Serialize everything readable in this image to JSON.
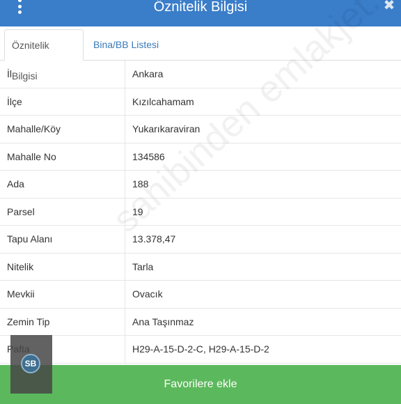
{
  "header": {
    "title": "Öznitelik Bilgisi",
    "menu_icon": "vertical-dots-icon",
    "close_icon": "close-icon"
  },
  "tabs": [
    {
      "label": "Öznitelik Bilgisi",
      "active": true
    },
    {
      "label": "Bina/BB Listesi",
      "active": false
    }
  ],
  "rows": [
    {
      "key": "İl",
      "value": "Ankara"
    },
    {
      "key": "İlçe",
      "value": "Kızılcahamam"
    },
    {
      "key": "Mahalle/Köy",
      "value": "Yukarıkaraviran"
    },
    {
      "key": "Mahalle No",
      "value": "134586"
    },
    {
      "key": "Ada",
      "value": "188"
    },
    {
      "key": "Parsel",
      "value": "19"
    },
    {
      "key": "Tapu Alanı",
      "value": "13.378,47"
    },
    {
      "key": "Nitelik",
      "value": "Tarla"
    },
    {
      "key": "Mevkii",
      "value": "Ovacık"
    },
    {
      "key": "Zemin Tip",
      "value": "Ana Taşınmaz"
    },
    {
      "key": "Pafta",
      "value": "H29-A-15-D-2-C, H29-A-15-D-2"
    }
  ],
  "watermark": "sahibinden emlakjet.com",
  "footer": {
    "button_label": "Favorilere ekle"
  },
  "badge": {
    "label": "SB"
  },
  "colors": {
    "header": "#3a7dc9",
    "footer": "#5cb85c",
    "tab_link": "#3a79b8"
  }
}
